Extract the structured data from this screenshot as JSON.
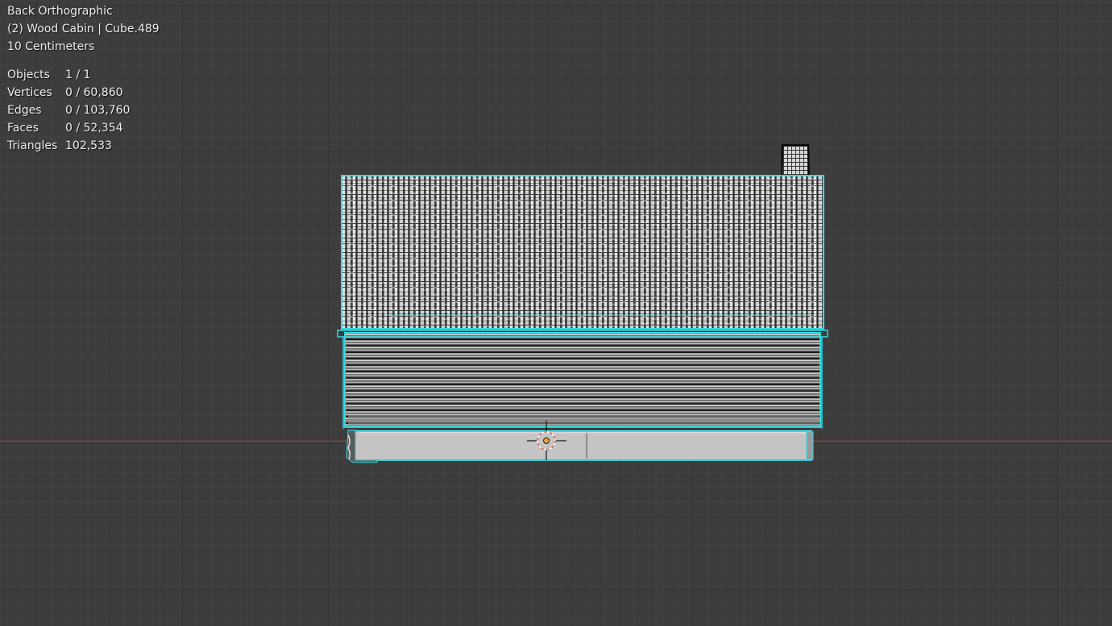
{
  "viewport": {
    "view_name": "Back Orthographic",
    "object_info": "(2) Wood Cabin | Cube.489",
    "scale": "10 Centimeters"
  },
  "stats": {
    "objects": {
      "label": "Objects",
      "value": "1 / 1"
    },
    "vertices": {
      "label": "Vertices",
      "value": "0 / 60,860"
    },
    "edges": {
      "label": "Edges",
      "value": "0 / 103,760"
    },
    "faces": {
      "label": "Faces",
      "value": "0 / 52,354"
    },
    "triangles": {
      "label": "Triangles",
      "value": "102,533"
    }
  },
  "colors": {
    "background": "#3d3d3d",
    "selection_outline": "#36d8e0",
    "x_axis": "#a94848",
    "cursor_ring": "#e05a4a",
    "origin": "#e8a33c"
  }
}
